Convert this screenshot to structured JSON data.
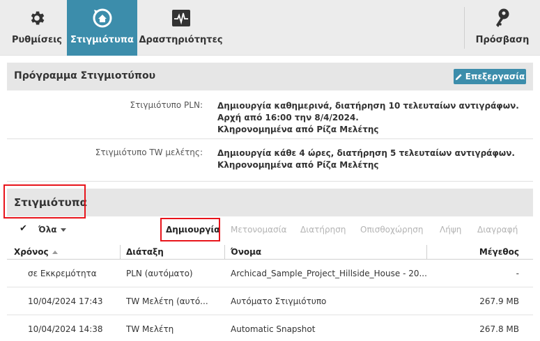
{
  "toolbar": {
    "tabs": [
      {
        "label": "Ρυθμίσεις",
        "icon": "gear-icon",
        "active": false
      },
      {
        "label": "Στιγμιότυπα",
        "icon": "snapshot-history-icon",
        "active": true
      },
      {
        "label": "Δραστηριότητες",
        "icon": "activity-pulse-icon",
        "active": false
      }
    ],
    "access": {
      "label": "Πρόσβαση",
      "icon": "key-icon"
    }
  },
  "colors": {
    "accent": "#3c8dab",
    "highlight": "#e8141b",
    "header_bg": "#e6e6e6"
  },
  "schedule": {
    "title": "Πρόγραμμα Στιγμιοτύπου",
    "edit_label": "Επεξεργασία",
    "rows": [
      {
        "label": "Στιγμιότυπο PLN:",
        "lines": [
          "Δημιουργία καθημερινά, διατήρηση 10 τελευταίων αντιγράφων.",
          "Αρχή από 16:00 την 8/4/2024.",
          "Κληρονομημένα από Ρίζα Μελέτης"
        ]
      },
      {
        "label": "Στιγμιότυπο TW μελέτης:",
        "lines": [
          "Δημιουργία κάθε 4 ώρες, διατήρηση 5 τελευταίων αντιγράφων.",
          "Κληρονομημένα από Ρίζα Μελέτης"
        ]
      }
    ]
  },
  "snapshots": {
    "title": "Στιγμιότυπα",
    "select_all": "Όλα",
    "actions": {
      "create": "Δημιουργία",
      "rename": "Μετονομασία",
      "retain": "Διατήρηση",
      "rollback": "Οπισθοχώρηση",
      "download": "Λήψη",
      "delete": "Διαγραφή"
    },
    "columns": {
      "time": "Χρόνος",
      "layout": "Διάταξη",
      "name": "Όνομα",
      "size": "Μέγεθος"
    },
    "rows": [
      {
        "time": "σε Εκκρεμότητα",
        "layout": "PLN (αυτόματο)",
        "name": "Archicad_Sample_Project_Hillside_House - 20...",
        "size": "-"
      },
      {
        "time": "10/04/2024 17:43",
        "layout": "TW Μελέτη (αυτό...",
        "name": "Αυτόματο Στιγμιότυπο",
        "size": "267.9 MB"
      },
      {
        "time": "10/04/2024 14:38",
        "layout": "TW Μελέτη",
        "name": "Automatic Snapshot",
        "size": "267.8 MB"
      }
    ]
  }
}
